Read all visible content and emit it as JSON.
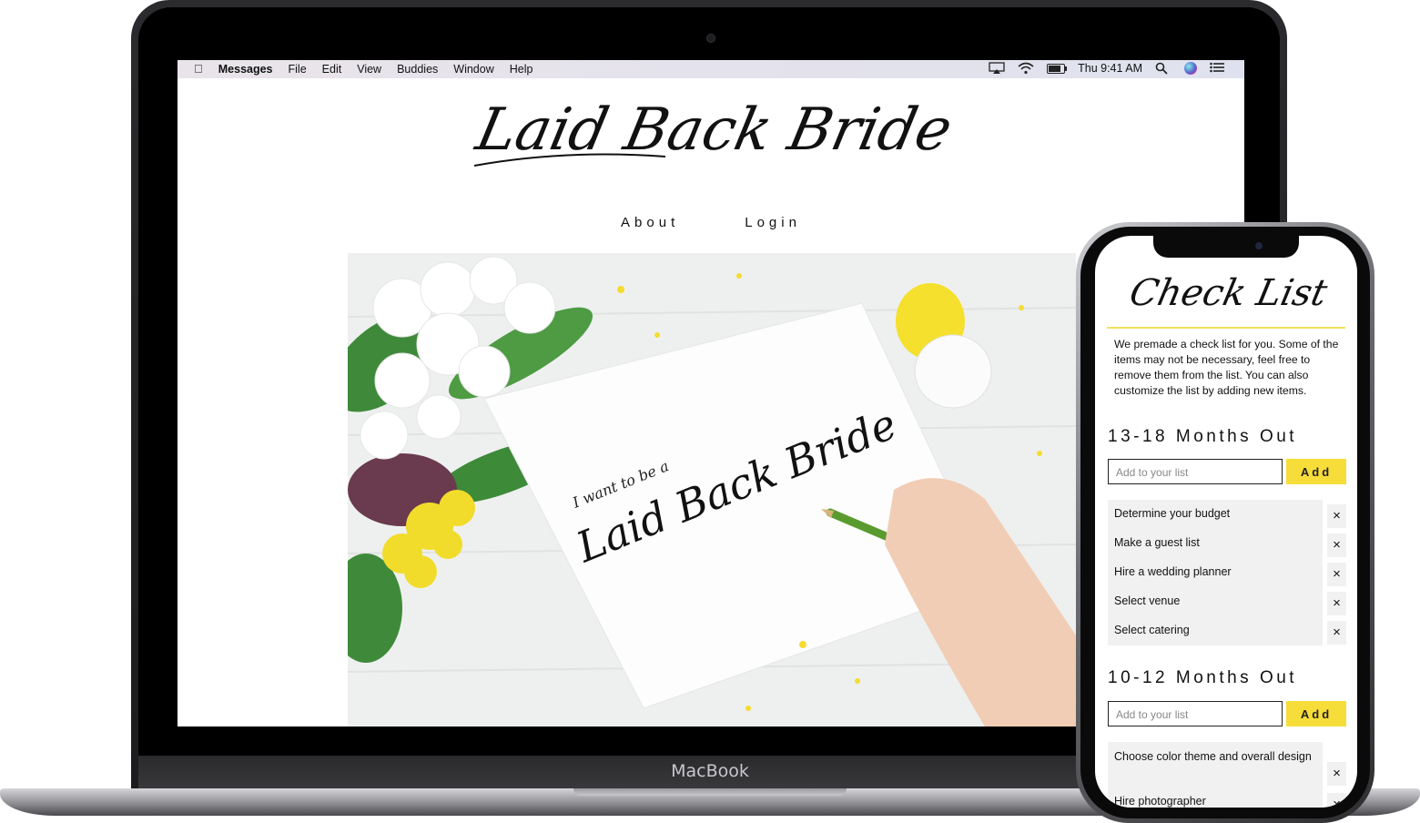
{
  "menubar": {
    "app_name": "Messages",
    "menus": [
      "File",
      "Edit",
      "View",
      "Buddies",
      "Window",
      "Help"
    ],
    "clock": "Thu 9:41 AM",
    "icons": [
      "apple-icon",
      "airplay-icon",
      "wifi-icon",
      "battery-icon",
      "search-icon",
      "siri-icon",
      "list-icon"
    ]
  },
  "laptop": {
    "brand_label": "MacBook"
  },
  "website": {
    "logo_text": "Laid Back Bride",
    "nav": [
      "About",
      "Login"
    ],
    "hero": {
      "note_line1": "I want to be a",
      "note_line2": "Laid Back Bride"
    }
  },
  "phone": {
    "title": "Check List",
    "intro": "We premade a check list for you. Some of the items may not be necessary, feel free to remove them from the list. You can also customize the list by adding new items.",
    "sections": [
      {
        "title": "13-18 Months Out",
        "input_placeholder": "Add to your list",
        "add_label": "Add",
        "items": [
          "Determine your budget",
          "Make a guest list",
          "Hire a wedding planner",
          "Select venue",
          "Select catering"
        ]
      },
      {
        "title": "10-12 Months Out",
        "input_placeholder": "Add to your list",
        "add_label": "Add",
        "items": [
          "Choose color theme and overall design",
          "Hire photographer"
        ]
      }
    ],
    "remove_symbol": "×"
  },
  "colors": {
    "accent_yellow": "#f7dd3a",
    "divider_yellow": "#f5e25a",
    "list_bg": "#f1f1f1"
  }
}
